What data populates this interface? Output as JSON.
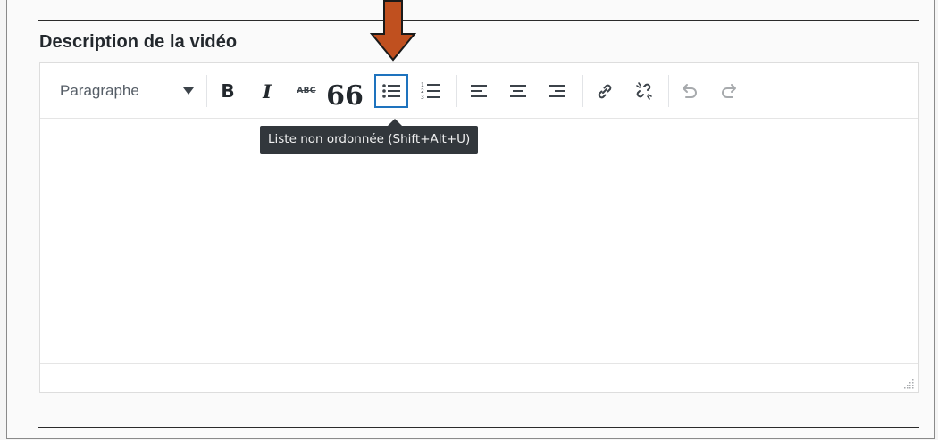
{
  "section": {
    "title": "Description de la vidéo"
  },
  "toolbar": {
    "format_select": {
      "value": "Paragraphe",
      "icon": "chevron-down-icon"
    },
    "buttons": [
      {
        "id": "bold",
        "label": "B",
        "icon": "bold-icon"
      },
      {
        "id": "italic",
        "label": "I",
        "icon": "italic-icon"
      },
      {
        "id": "strikethrough",
        "label": "ABC",
        "icon": "strikethrough-icon"
      },
      {
        "id": "blockquote",
        "label": "66",
        "icon": "blockquote-icon"
      },
      {
        "id": "bullet-list",
        "icon": "bullet-list-icon",
        "active": true
      },
      {
        "id": "numbered-list",
        "icon": "numbered-list-icon"
      },
      {
        "id": "align-left",
        "icon": "align-left-icon"
      },
      {
        "id": "align-center",
        "icon": "align-center-icon"
      },
      {
        "id": "align-right",
        "icon": "align-right-icon"
      },
      {
        "id": "insert-link",
        "icon": "link-icon"
      },
      {
        "id": "remove-link",
        "icon": "unlink-icon"
      },
      {
        "id": "undo",
        "icon": "undo-icon"
      },
      {
        "id": "redo",
        "icon": "redo-icon"
      }
    ]
  },
  "tooltip": {
    "text": "Liste non ordonnée (Shift+Alt+U)"
  },
  "annotation": {
    "icon": "down-arrow-icon",
    "color": "#c0501f"
  },
  "colors": {
    "active_border": "#1e73be",
    "tooltip_bg": "#32373c",
    "toolbar_icon": "#3c434a"
  }
}
